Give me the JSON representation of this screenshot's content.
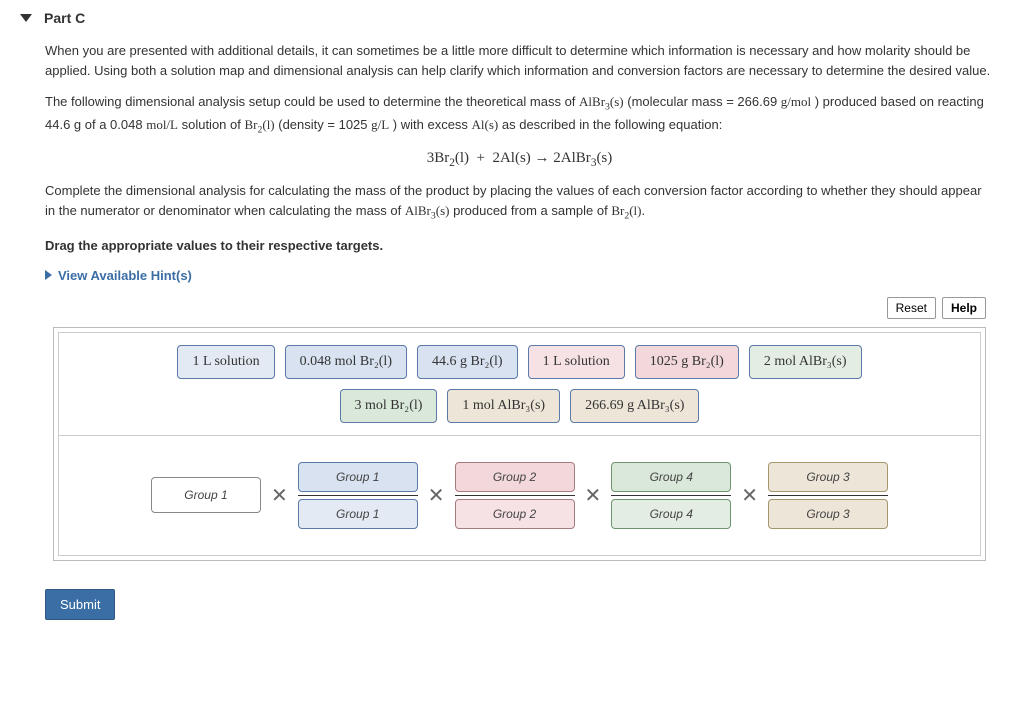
{
  "header": {
    "title": "Part C"
  },
  "paras": {
    "p1": "When you are presented with additional details, it can sometimes be a little more difficult to determine which information is necessary and how molarity should be applied. Using both a solution map and dimensional analysis can help clarify which information and conversion factors are necessary to determine the desired value.",
    "p2a": "The following dimensional analysis setup could be used to determine the theoretical mass of ",
    "p2b": " (molecular mass = 266.69 ",
    "p2c": " ) produced based on reacting 44.6 g of a 0.048 ",
    "p2d": " solution of ",
    "p2e": " (density = 1025 ",
    "p2f": " ) with excess ",
    "p2g": " as described in the following equation:",
    "eq_left": "3Br",
    "eq_a": "(l)  +  2Al(s) → 2AlBr",
    "p3a": "Complete the dimensional analysis for calculating the mass of the product by placing the values of each conversion factor according to whether they should appear in the numerator or denominator when calculating the mass of ",
    "p3b": " produced from a sample of ",
    "p3c": ".",
    "drag": "Drag the appropriate values to their respective targets.",
    "hints": "View Available Hint(s)"
  },
  "units": {
    "gmol": "g/mol",
    "molL": "mol/L",
    "gL": "g/L"
  },
  "species": {
    "albr3s": "AlBr₃(s)",
    "br2l": "Br₂(l)",
    "als": "Al(s)"
  },
  "toolbar": {
    "reset": "Reset",
    "help": "Help"
  },
  "chips": {
    "r1": [
      "1 L solution",
      "0.048 mol  Br₂(l)",
      "44.6 g  Br₂(l)",
      "1 L solution",
      "1025 g  Br₂(l)",
      "2 mol  AlBr₃(s)"
    ],
    "r2": [
      "3 mol  Br₂(l)",
      "1 mol  AlBr₃(s)",
      "266.69 g  AlBr₃(s)"
    ]
  },
  "targets": {
    "single": "Group 1",
    "fracs": [
      {
        "top": "Group 1",
        "bot": "Group 1"
      },
      {
        "top": "Group 2",
        "bot": "Group 2"
      },
      {
        "top": "Group 4",
        "bot": "Group 4"
      },
      {
        "top": "Group 3",
        "bot": "Group 3"
      }
    ]
  },
  "submit": "Submit"
}
